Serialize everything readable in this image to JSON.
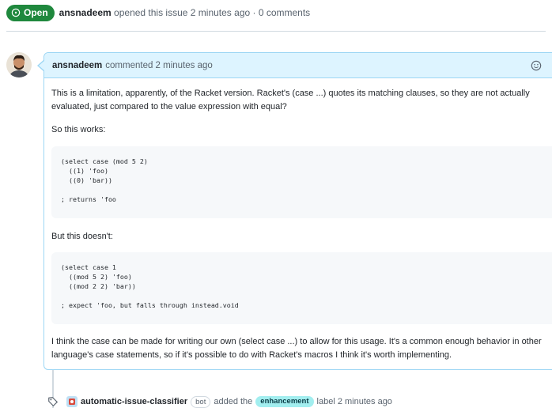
{
  "header": {
    "status_label": "Open",
    "author": "ansnadeem",
    "meta": "opened this issue 2 minutes ago · 0 comments"
  },
  "comment": {
    "author": "ansnadeem",
    "meta": "commented 2 minutes ago",
    "paragraph1": "This is a limitation, apparently, of the Racket version. Racket's (case ...) quotes its matching clauses, so they are not actually evaluated, just compared to the value expression with equal?",
    "paragraph2": "So this works:",
    "code1": "(select case (mod 5 2)\n  ((1) 'foo)\n  ((0) 'bar))\n\n; returns 'foo",
    "paragraph3": "But this doesn't:",
    "code2": "(select case 1\n  ((mod 5 2) 'foo)\n  ((mod 2 2) 'bar))\n\n; expect 'foo, but falls through instead.void",
    "paragraph4": "I think the case can be made for writing our own (select case ...) to allow for this usage. It's a common enough behavior in other language's case statements, so if it's possible to do with Racket's macros I think it's worth implementing."
  },
  "event": {
    "bot_name": "automatic-issue-classifier",
    "bot_badge": "bot",
    "action": "added the",
    "label": "enhancement",
    "suffix": "label 2 minutes ago"
  },
  "colors": {
    "open_green": "#1f883d",
    "comment_header_bg": "#ddf4ff",
    "comment_border": "#9cd6f4",
    "label_bg": "#a2eeef"
  },
  "icons": [
    "issue-opened-icon",
    "smiley-icon",
    "tag-icon",
    "avatar",
    "bot-avatar"
  ]
}
